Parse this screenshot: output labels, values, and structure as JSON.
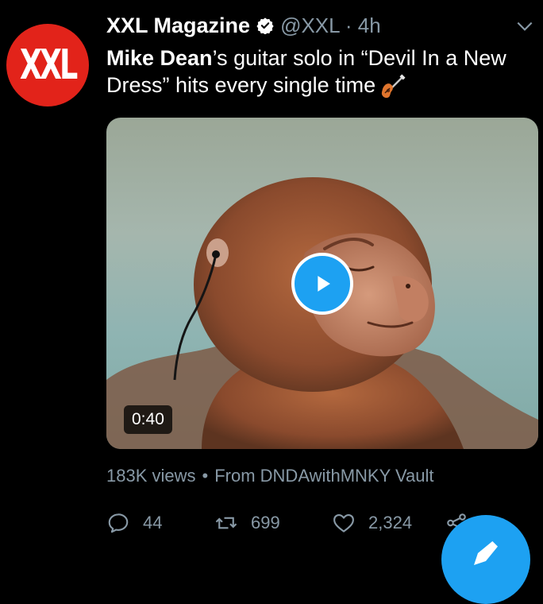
{
  "tweet": {
    "avatar_text": "XXL",
    "display_name": "XXL Magazine",
    "handle_time": "@XXL · 4h",
    "text_bold": "Mike Dean",
    "text_rest": "’s guitar solo in “Devil In a New Dress” hits every single time"
  },
  "media": {
    "duration": "0:40"
  },
  "meta": {
    "views": "183K views",
    "separator": "•",
    "source": "From DNDAwithMNKY Vault"
  },
  "actions": {
    "replies": "44",
    "retweets": "699",
    "likes": "2,324"
  },
  "colors": {
    "background": "#000000",
    "accent": "#1da1f2",
    "muted": "#8899a6",
    "brand_red": "#e2231a"
  },
  "icons": [
    "verified-badge-icon",
    "chevron-down-icon",
    "guitar-icon",
    "play-icon",
    "reply-icon",
    "retweet-icon",
    "like-icon",
    "share-icon",
    "compose-icon"
  ]
}
